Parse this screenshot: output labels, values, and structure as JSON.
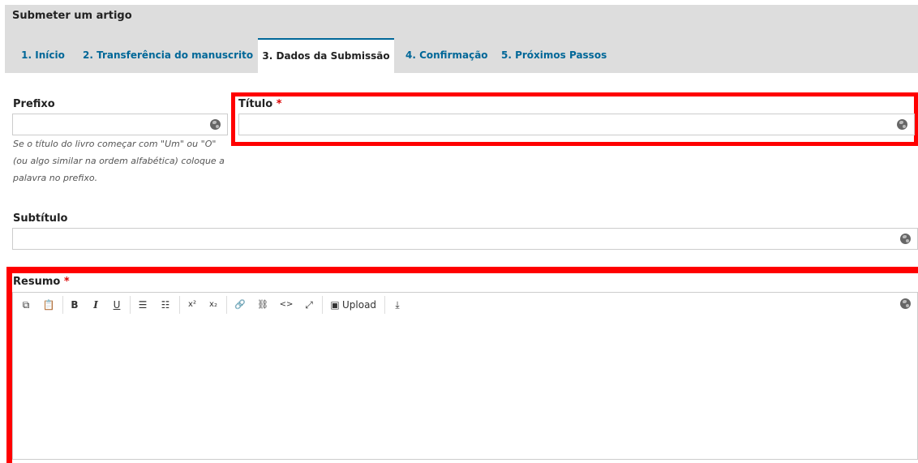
{
  "header": {
    "title": "Submeter um artigo"
  },
  "tabs": [
    {
      "label": "1. Início"
    },
    {
      "label": "2. Transferência do manuscrito"
    },
    {
      "label": "3. Dados da Submissão"
    },
    {
      "label": "4. Confirmação"
    },
    {
      "label": "5. Próximos Passos"
    }
  ],
  "active_tab_index": 2,
  "form": {
    "prefix": {
      "label": "Prefixo",
      "value": "",
      "help_lines": [
        "Se o título do livro começar com \"Um\" ou \"O\"",
        "(ou algo similar na ordem alfabética) coloque a",
        "palavra no prefixo."
      ]
    },
    "title": {
      "label": "Título",
      "required_mark": "*",
      "value": ""
    },
    "subtitle": {
      "label": "Subtítulo",
      "value": ""
    },
    "abstract": {
      "label": "Resumo",
      "required_mark": "*",
      "value": ""
    }
  },
  "toolbar": {
    "buttons": [
      {
        "name": "copy-icon",
        "glyph": "⧉"
      },
      {
        "name": "paste-icon",
        "glyph": "📋"
      },
      {
        "name": "bold-icon",
        "glyph": "B"
      },
      {
        "name": "italic-icon",
        "glyph": "I"
      },
      {
        "name": "underline-icon",
        "glyph": "U"
      },
      {
        "name": "bullet-list-icon",
        "glyph": "☰"
      },
      {
        "name": "numbered-list-icon",
        "glyph": "☷"
      },
      {
        "name": "superscript-icon",
        "glyph": "x²"
      },
      {
        "name": "subscript-icon",
        "glyph": "x₂"
      },
      {
        "name": "link-icon",
        "glyph": "🔗"
      },
      {
        "name": "unlink-icon",
        "glyph": "⛓"
      },
      {
        "name": "code-icon",
        "glyph": "<>"
      },
      {
        "name": "fullscreen-icon",
        "glyph": "⤢"
      },
      {
        "name": "image-icon",
        "glyph": "▣"
      }
    ],
    "upload_label": "Upload",
    "insert_icon_glyph": "⤓"
  },
  "colors": {
    "accent": "#006798",
    "highlight": "#ff0000",
    "required": "#dd0000",
    "header_bg": "#dddddd"
  }
}
